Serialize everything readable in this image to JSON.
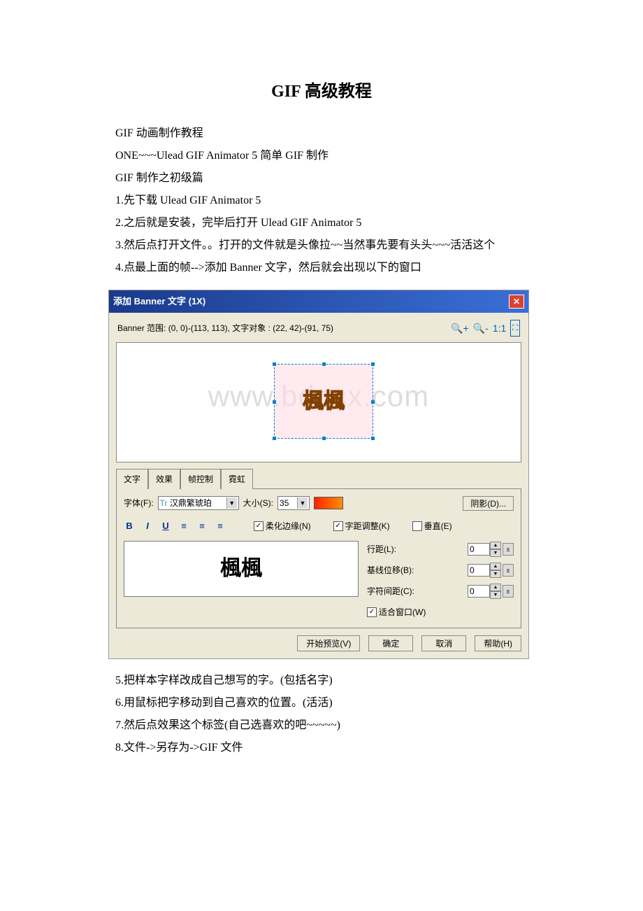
{
  "title": "GIF 高级教程",
  "body": {
    "p1": "GIF 动画制作教程",
    "p2": "ONE~~~Ulead GIF Animator 5 简单 GIF 制作",
    "p3": "GIF 制作之初级篇",
    "p4": "1.先下载 Ulead GIF Animator 5",
    "p5": "2.之后就是安装，完毕后打开 Ulead GIF Animator 5",
    "p6": "3.然后点打开文件。。打开的文件就是头像拉~~当然事先要有头头~~~活活这个",
    "p7": "4.点最上面的帧-->添加 Banner 文字，然后就会出现以下的窗口",
    "p8": "5.把样本字样改成自己想写的字。(包括名字)",
    "p9": "6.用鼠标把字移动到自己喜欢的位置。(活活)",
    "p10": "7.然后点效果这个标签(自己选喜欢的吧~~~~~)",
    "p11": "8.文件->另存为->GIF 文件"
  },
  "dialog": {
    "title": "添加 Banner 文字 (1X)",
    "info": "Banner 范围: (0, 0)-(113, 113), 文字对象 : (22, 42)-(91, 75)",
    "ratio": "1:1",
    "sample_text": "楓楓",
    "watermark": "www.bdocx.com",
    "tabs": {
      "t1": "文字",
      "t2": "效果",
      "t3": "帧控制",
      "t4": "霓虹"
    },
    "font_label": "字体(F):",
    "font_value": "汉鼎繁琥珀",
    "size_label": "大小(S):",
    "size_value": "35",
    "shadow_btn": "阴影(D)...",
    "soften_label": "柔化边缘(N)",
    "kerning_label": "字距调整(K)",
    "vertical_label": "垂直(E)",
    "line_label": "行距(L):",
    "baseline_label": "基线位移(B):",
    "char_label": "字符间距(C):",
    "fit_label": "适合窗口(W)",
    "spin_val": "0",
    "actions": {
      "preview": "开始预览(V)",
      "ok": "确定",
      "cancel": "取消",
      "help": "帮助(H)"
    }
  }
}
